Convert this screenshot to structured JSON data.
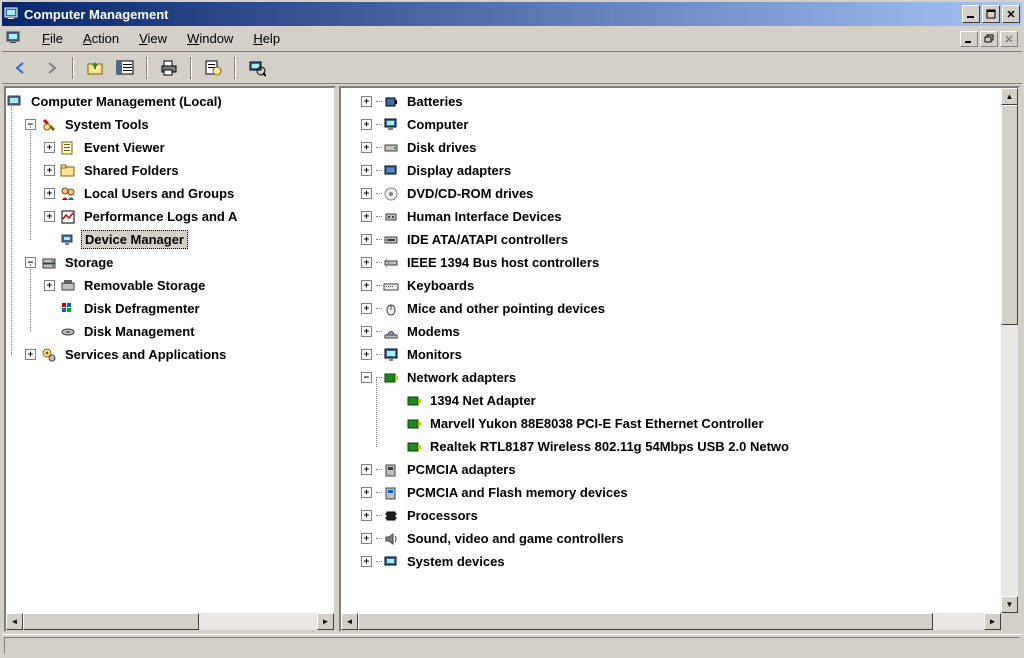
{
  "window": {
    "title": "Computer Management"
  },
  "menu": {
    "file": "File",
    "action": "Action",
    "view": "View",
    "windowm": "Window",
    "help": "Help"
  },
  "left_tree": {
    "root": "Computer Management (Local)",
    "system_tools": "System Tools",
    "event_viewer": "Event Viewer",
    "shared_folders": "Shared Folders",
    "local_users": "Local Users and Groups",
    "perf_logs": "Performance Logs and A",
    "device_manager": "Device Manager",
    "storage": "Storage",
    "removable_storage": "Removable Storage",
    "disk_defrag": "Disk Defragmenter",
    "disk_mgmt": "Disk Management",
    "services_apps": "Services and Applications"
  },
  "right_tree": {
    "batteries": "Batteries",
    "computer": "Computer",
    "disk_drives": "Disk drives",
    "display_adapters": "Display adapters",
    "dvd": "DVD/CD-ROM drives",
    "hid": "Human Interface Devices",
    "ide": "IDE ATA/ATAPI controllers",
    "ieee1394": "IEEE 1394 Bus host controllers",
    "keyboards": "Keyboards",
    "mice": "Mice and other pointing devices",
    "modems": "Modems",
    "monitors": "Monitors",
    "network_adapters": "Network adapters",
    "net1": "1394 Net Adapter",
    "net2": "Marvell Yukon 88E8038 PCI-E Fast Ethernet Controller",
    "net3": "Realtek RTL8187 Wireless 802.11g 54Mbps USB 2.0 Netwo",
    "pcmcia": "PCMCIA adapters",
    "pcmcia_flash": "PCMCIA and Flash memory devices",
    "processors": "Processors",
    "sound": "Sound, video and game controllers",
    "system_devices": "System devices"
  }
}
